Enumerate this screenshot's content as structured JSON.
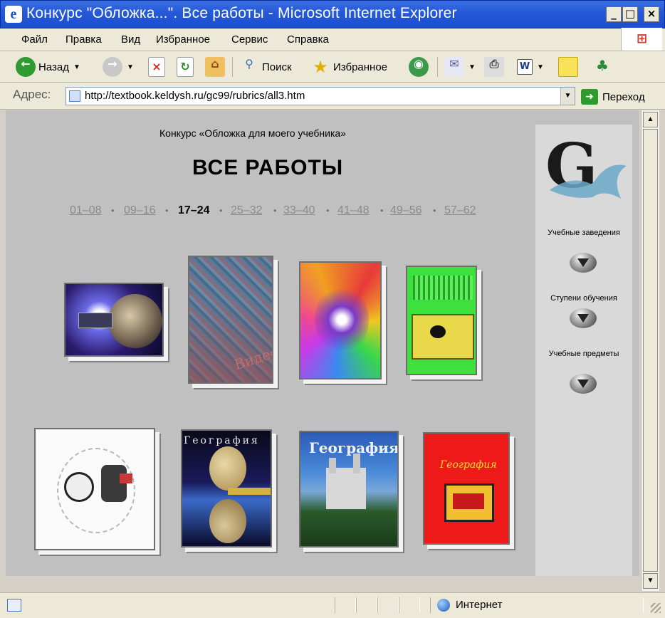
{
  "window": {
    "title": "Конкурс \"Обложка...\". Все работы - Microsoft Internet Explorer",
    "controls": {
      "minimize": "_",
      "maximize": "□",
      "close": "×"
    }
  },
  "menu": [
    "Файл",
    "Правка",
    "Вид",
    "Избранное",
    "Сервис",
    "Справка"
  ],
  "toolbar": {
    "back": "Назад",
    "search": "Поиск",
    "favorites": "Избранное"
  },
  "address": {
    "label": "Адрес:",
    "url": "http://textbook.keldysh.ru/gc99/rubrics/all3.htm",
    "go": "Переход"
  },
  "page": {
    "subtitle": "Конкурс «Обложка для моего учебника»",
    "title": "ВСЕ  РАБОТЫ",
    "pages": [
      {
        "label": "01–08",
        "current": false
      },
      {
        "label": "09–16",
        "current": false
      },
      {
        "label": "17–24",
        "current": true
      },
      {
        "label": "25–32",
        "current": false
      },
      {
        "label": "33–40",
        "current": false
      },
      {
        "label": "41–48",
        "current": false
      },
      {
        "label": "49–56",
        "current": false
      },
      {
        "label": "57–62",
        "current": false
      }
    ],
    "page_separator": "•",
    "books": [
      {
        "name": "cover-space"
      },
      {
        "name": "cover-blue-texture",
        "text": "Видео"
      },
      {
        "name": "cover-psychedelic"
      },
      {
        "name": "cover-green"
      },
      {
        "name": "cover-sketch"
      },
      {
        "name": "cover-geography-moon",
        "text": "География"
      },
      {
        "name": "cover-geography-castle",
        "text": "География"
      },
      {
        "name": "cover-geography-red",
        "text": "География"
      }
    ]
  },
  "sidebar": {
    "logo_text": "G",
    "sections": [
      "Учебные заведения",
      "Ступени обучения",
      "Учебные предметы"
    ]
  },
  "status": {
    "zone": "Интернет"
  },
  "colors": {
    "title_bar": "#2458d8",
    "chrome": "#ece9d8",
    "content_bg": "#c0c0c0",
    "sidebar_bg": "#d9d9d9"
  }
}
